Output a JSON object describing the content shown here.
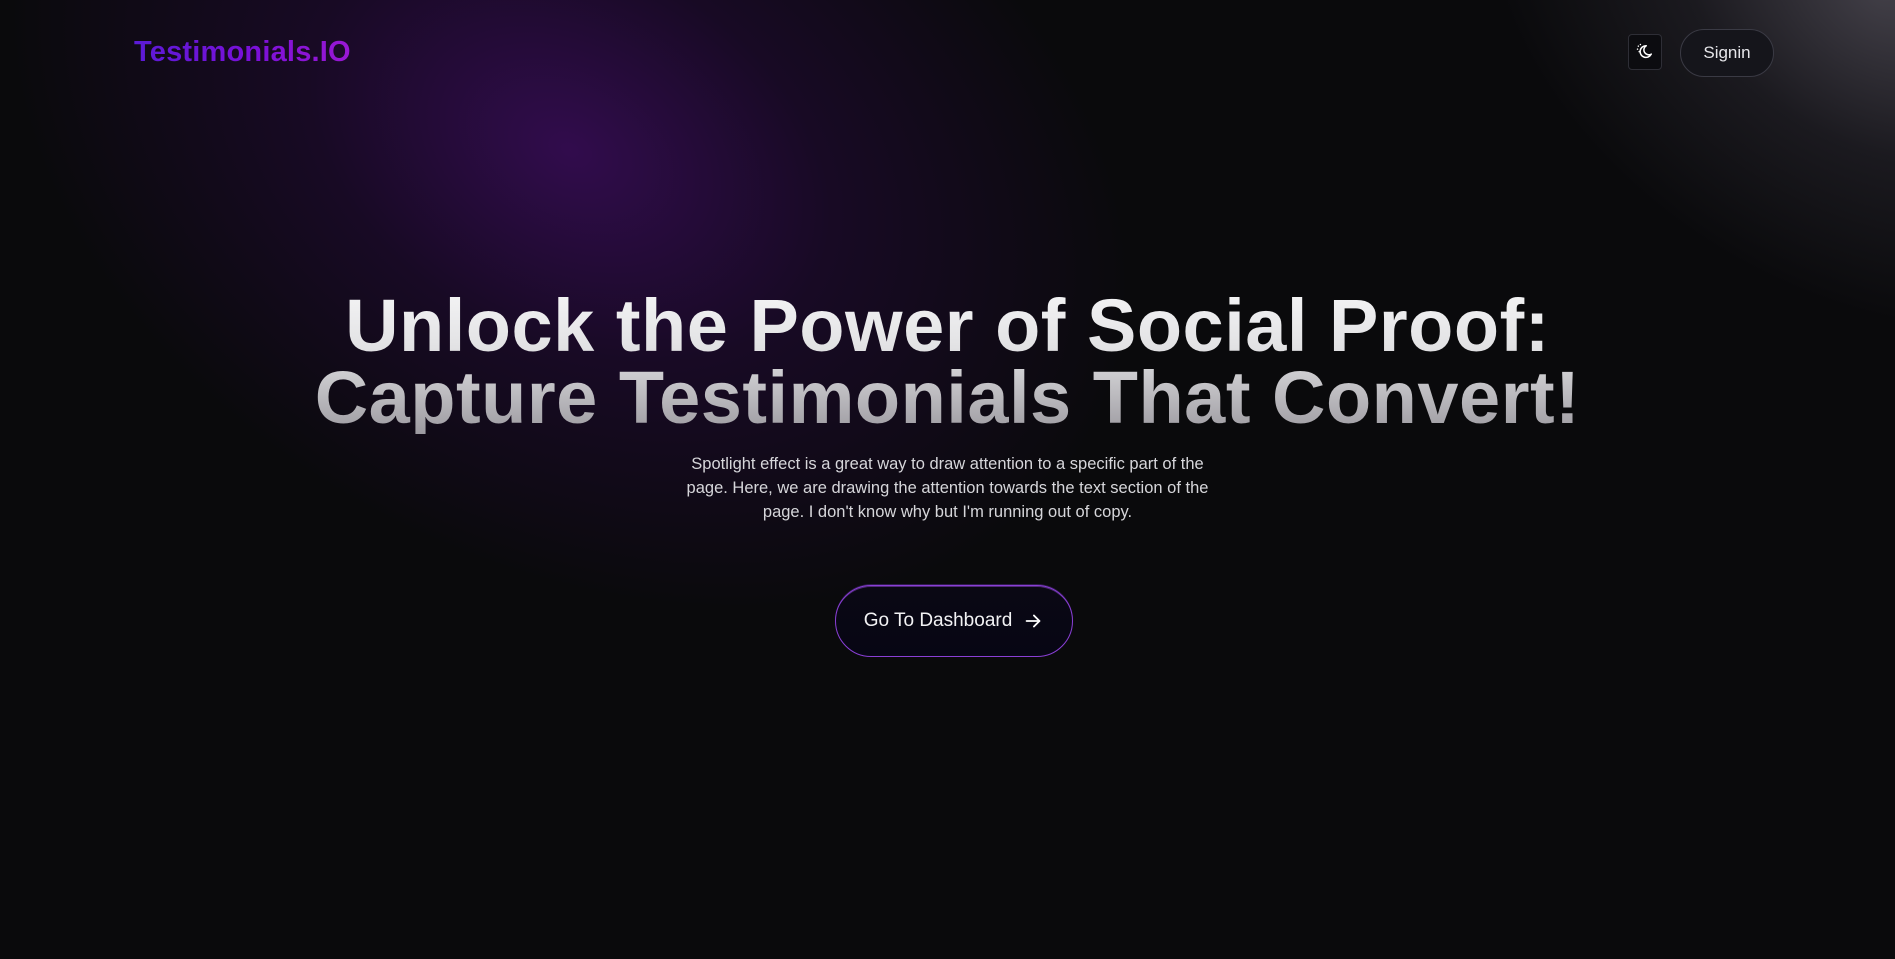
{
  "navbar": {
    "logo": "Testimonials.IO",
    "theme_toggle_icon": "moon-sun-icon",
    "signin_label": "Signin"
  },
  "hero": {
    "title_line1": "Unlock the Power of Social Proof:",
    "title_line2": "Capture Testimonials That Convert!",
    "subtitle": "Spotlight effect is a great way to draw attention to a specific part of the page. Here, we are drawing the attention towards the text section of the page. I don't know why but I'm running out of copy.",
    "cta_label": "Go To Dashboard",
    "cta_icon": "arrow-right-icon"
  },
  "colors": {
    "background": "#0a0a0c",
    "logo_gradient_start": "#5b1bd6",
    "logo_gradient_end": "#9a18d4",
    "cta_border": "#8a3fd6"
  }
}
